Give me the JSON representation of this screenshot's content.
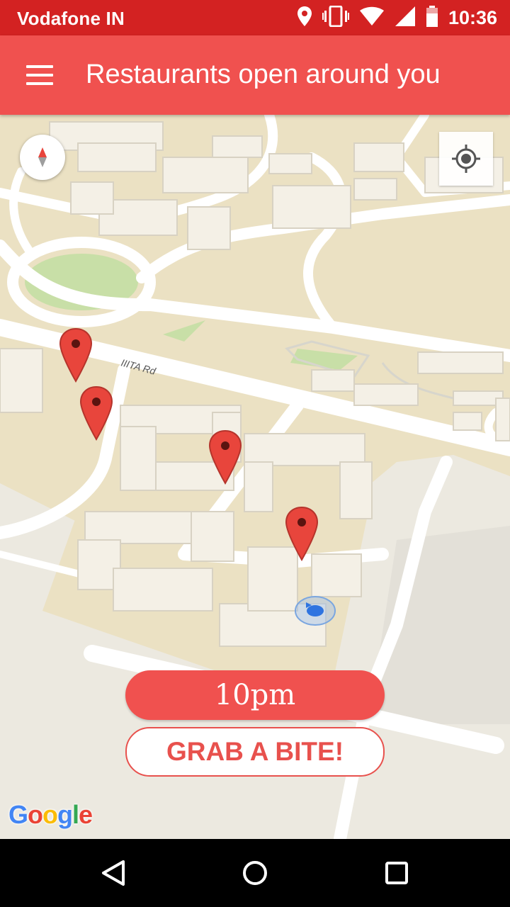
{
  "status_bar": {
    "carrier": "Vodafone IN",
    "time": "10:36",
    "icons": [
      "location-icon",
      "vibrate-icon",
      "wifi-icon",
      "signal-icon",
      "battery-icon"
    ]
  },
  "app_bar": {
    "title": "Restaurants open around you",
    "menu_icon": "hamburger-menu-icon"
  },
  "map": {
    "road_label": "IIITA Rd",
    "markers": [
      "restaurant-marker-1",
      "restaurant-marker-2",
      "restaurant-marker-3",
      "restaurant-marker-4"
    ],
    "controls": [
      "compass-icon",
      "my-location-icon"
    ],
    "attribution": "Google"
  },
  "actions": {
    "time_value": "10pm",
    "grab_label": "GRAB A BITE!"
  },
  "nav_bar": {
    "buttons": [
      "back-icon",
      "home-icon",
      "recents-icon"
    ]
  },
  "colors": {
    "status_bar": "#d32222",
    "app_bar": "#f0514f",
    "accent": "#e8514d",
    "map_land": "#ece9e0",
    "map_campus": "#ebe1c3",
    "park": "#c8dfa7",
    "marker": "#e8453c"
  }
}
